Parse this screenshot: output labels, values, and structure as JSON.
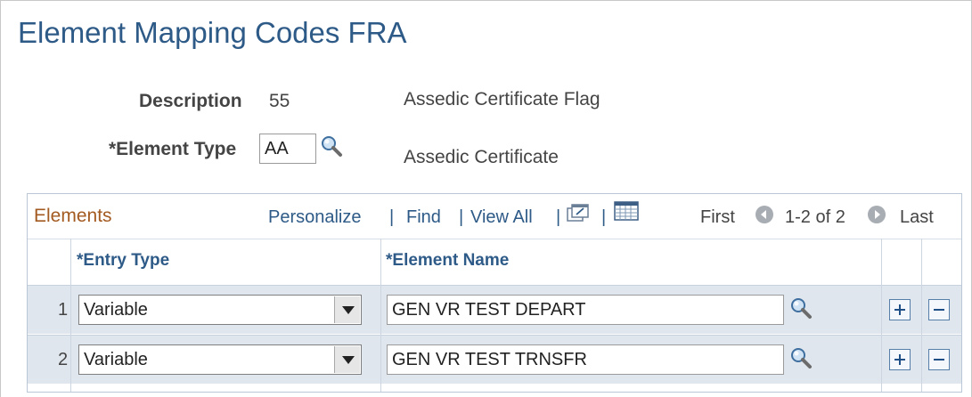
{
  "page": {
    "title": "Element Mapping Codes FRA"
  },
  "form": {
    "description_label": "Description",
    "description_value": "55",
    "description_text": "Assedic Certificate Flag",
    "element_type_label": "*Element Type",
    "element_type_value": "AA",
    "element_type_desc": "Assedic Certificate"
  },
  "grid": {
    "title": "Elements",
    "links": {
      "personalize": "Personalize",
      "find": "Find",
      "view_all": "View All",
      "sep": "|"
    },
    "pager": {
      "first": "First",
      "range": "1-2 of 2",
      "last": "Last"
    },
    "columns": {
      "entry_type": "*Entry Type",
      "element_name": "*Element Name"
    },
    "rows": [
      {
        "num": "1",
        "entry_type": "Variable",
        "element_name": "GEN VR TEST DEPART"
      },
      {
        "num": "2",
        "entry_type": "Variable",
        "element_name": "GEN VR TEST TRNSFR"
      }
    ]
  },
  "icons": {
    "lookup": "magnifier-icon",
    "new_window": "new-window-icon",
    "download": "spreadsheet-icon",
    "prev": "arrow-left-circle-icon",
    "next": "arrow-right-circle-icon",
    "add_row": "plus-icon",
    "delete_row": "minus-icon"
  }
}
